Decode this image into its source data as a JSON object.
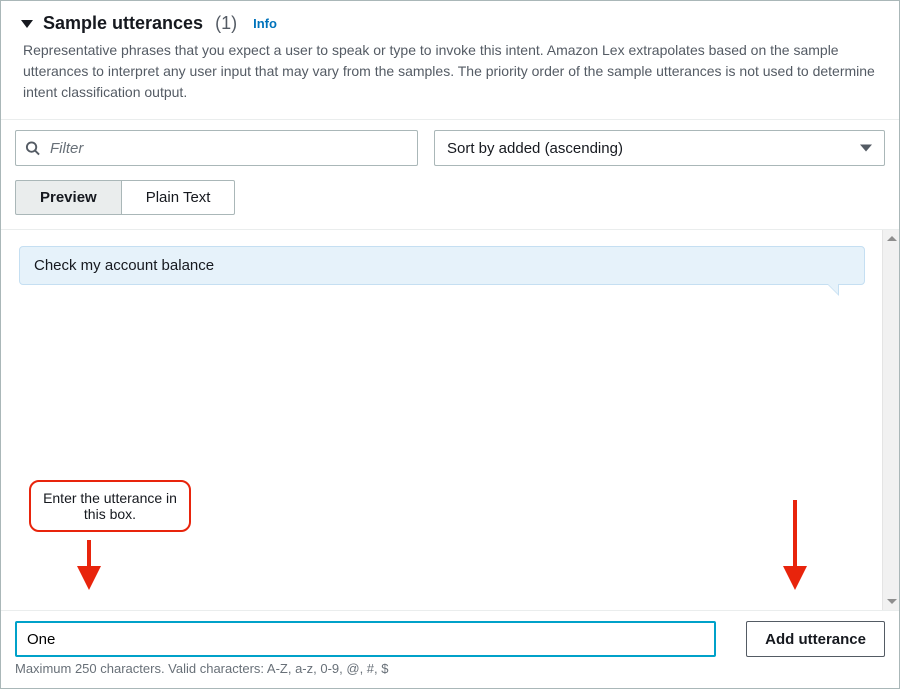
{
  "header": {
    "title": "Sample utterances",
    "count": "(1)",
    "info_link": "Info",
    "description": "Representative phrases that you expect a user to speak or type to invoke this intent. Amazon Lex extrapolates based on the sample utterances to interpret any user input that may vary from the samples. The priority order of the sample utterances is not used to determine intent classification output."
  },
  "filter": {
    "placeholder": "Filter"
  },
  "sort": {
    "selected": "Sort by added (ascending)"
  },
  "tabs": {
    "preview": "Preview",
    "plain_text": "Plain Text"
  },
  "utterances": [
    "Check my account balance"
  ],
  "callout": {
    "text": "Enter the utterance in this box."
  },
  "input": {
    "value": "One"
  },
  "add_button": "Add utterance",
  "hint": "Maximum 250 characters. Valid characters: A-Z, a-z, 0-9, @, #, $"
}
